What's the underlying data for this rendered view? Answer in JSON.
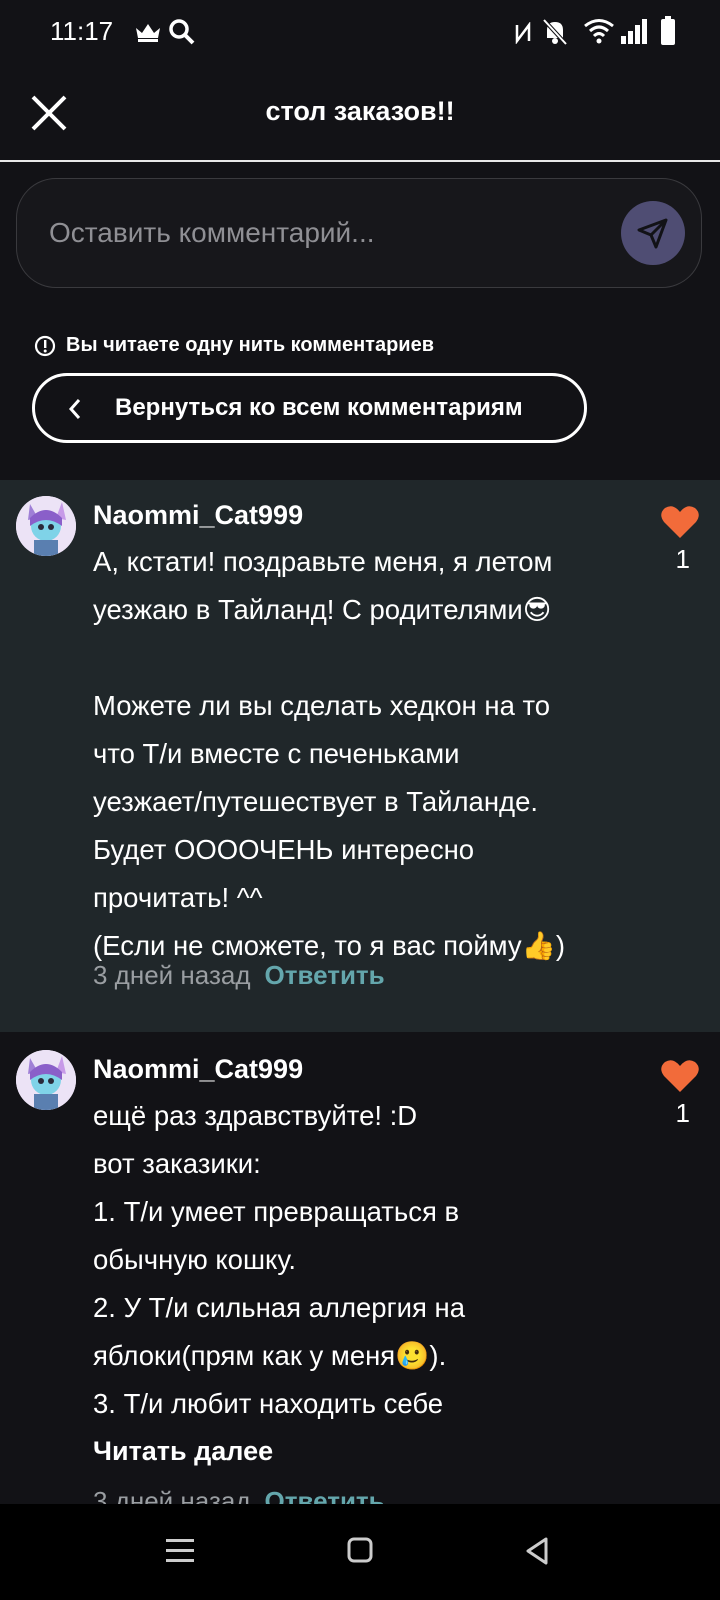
{
  "status": {
    "time": "11:17"
  },
  "header": {
    "title": "стол заказов!!"
  },
  "composer": {
    "placeholder": "Оставить комментарий..."
  },
  "thread": {
    "info": "Вы читаете одну нить комментариев",
    "back_label": "Вернуться ко всем комментариям"
  },
  "comments": [
    {
      "user": "Naommi_Cat999",
      "text": "А, кстати! поздравьте меня, я летом\nуезжаю в Тайланд! С родителями😎\n\nМожете ли вы сделать хедкон на то\nчто Т/и вместе с печеньками\nуезжает/путешествует в Тайланде.\nБудет ООООЧЕНЬ интересно\nпрочитать! ^^\n(Если не сможете, то я вас пойму👍)",
      "time": "3 дней назад",
      "reply": "Ответить",
      "likes": "1"
    },
    {
      "user": "Naommi_Cat999",
      "text": "ещё раз здравствуйте! :D\nвот заказики:\n1. Т/и умеет превращаться в\nобычную кошку.\n2. У Т/и сильная аллергия на\nяблоки(прям как у меня🥲).\n3. Т/и любит находить себе",
      "read_more": "Читать далее",
      "time": "3 дней назад",
      "reply": "Ответить",
      "likes": "1"
    }
  ],
  "colors": {
    "background": "#121216",
    "highlight": "#20272a",
    "accent": "#64a6ac",
    "like": "#f26b3a",
    "send": "#4f4d73"
  },
  "icons": [
    "close-icon",
    "send-icon",
    "info-icon",
    "chevron-left-icon",
    "heart-icon",
    "menu-icon",
    "home-icon",
    "back-icon"
  ]
}
